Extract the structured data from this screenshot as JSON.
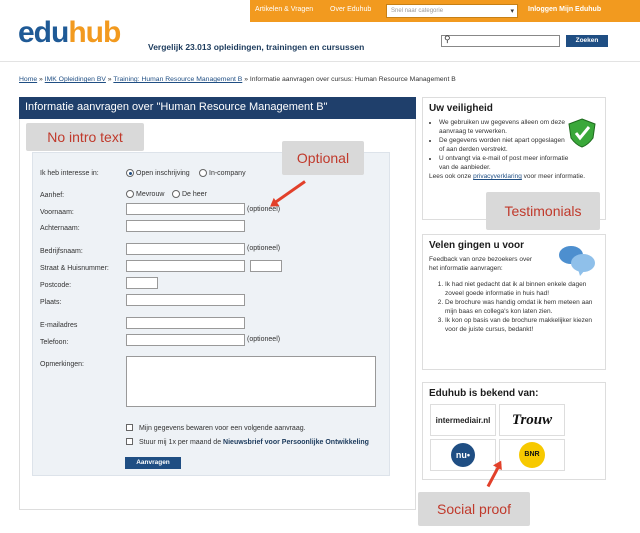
{
  "topbar": {
    "nav1": "Artikelen & Vragen",
    "nav2": "Over Eduhub",
    "category_placeholder": "Snel naar categorie",
    "login": "Inloggen Mijn Eduhub"
  },
  "header": {
    "logo_edu": "edu",
    "logo_hub": "hub",
    "tagline": "Vergelijk 23.013 opleidingen, trainingen en cursussen",
    "search_button": "Zoeken"
  },
  "breadcrumb": {
    "home": "Home",
    "sep": " » ",
    "provider": "IMK Opleidingen BV",
    "training": "Training: Human Resource Management B",
    "current": "Informatie aanvragen over cursus: Human Resource Management B"
  },
  "main": {
    "title": "Informatie aanvragen over \"Human Resource Management B\""
  },
  "notes": {
    "intro": "No intro text",
    "optional": "Optional",
    "testimonials": "Testimonials",
    "social": "Social proof"
  },
  "form": {
    "interest_label": "Ik heb interesse in:",
    "open": "Open inschrijving",
    "incompany": "In-company",
    "aanhef": "Aanhef:",
    "mevrouw": "Mevrouw",
    "deheer": "De heer",
    "voornaam": "Voornaam:",
    "optioneel": "(optioneel)",
    "achternaam": "Achternaam:",
    "bedrijfsnaam": "Bedrijfsnaam:",
    "straat": "Straat & Huisnummer:",
    "postcode": "Postcode:",
    "plaats": "Plaats:",
    "email": "E-mailadres",
    "telefoon": "Telefoon:",
    "opmerkingen": "Opmerkingen:",
    "bewaren": "Mijn gegevens bewaren voor een volgende aanvraag.",
    "nieuwsbrief_pre": "Stuur mij 1x per maand de ",
    "nieuwsbrief_bold": "Nieuwsbrief voor Persoonlijke Ontwikkeling",
    "submit": "Aanvragen"
  },
  "security": {
    "title": "Uw veiligheid",
    "items": [
      "We gebruiken uw gegevens alleen om deze aanvraag te verwerken.",
      "De gegevens worden niet apart opgeslagen of aan derden verstrekt.",
      "U ontvangt via e-mail of post meer informatie van de aanbieder."
    ],
    "read_pre": "Lees ook onze ",
    "read_link": "privacyverklaring",
    "read_post": " voor meer informatie."
  },
  "testimonials": {
    "title": "Velen gingen u voor",
    "intro": "Feedback van onze bezoekers over het informatie aanvragen:",
    "items": [
      "Ik had niet gedacht dat ik al binnen enkele dagen zoveel goede informatie in huis had!",
      "De brochure was handig omdat ik hem meteen aan mijn baas en collega's kon laten zien.",
      "Ik kon op basis van de brochure makkelijker kiezen voor de juiste cursus, bedankt!"
    ]
  },
  "known": {
    "title": "Eduhub is bekend van:",
    "logo1": "intermediair.nl",
    "logo2": "Trouw",
    "logo3": "nu•",
    "logo4": "BNR"
  }
}
